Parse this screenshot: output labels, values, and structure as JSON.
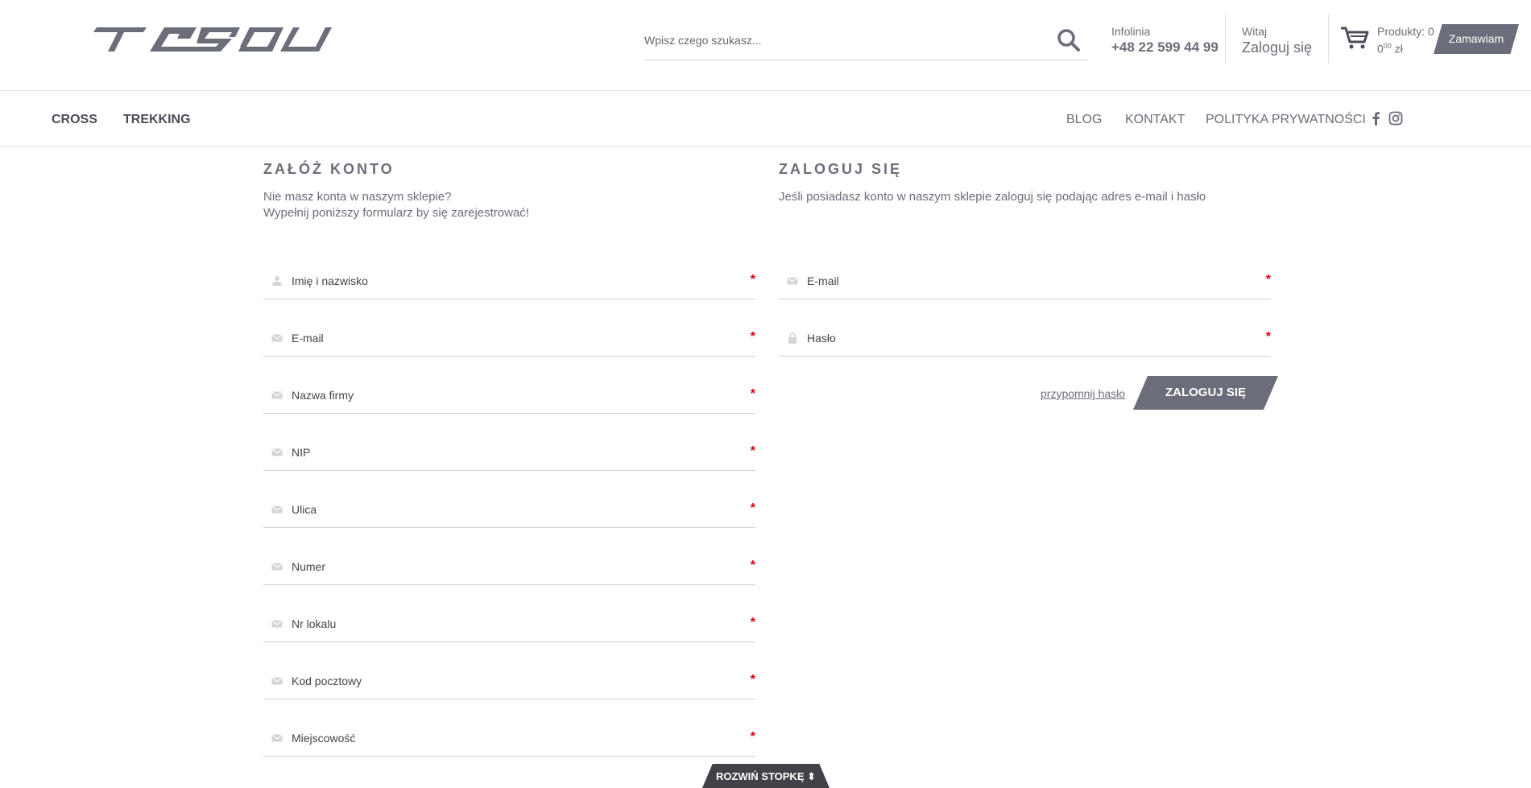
{
  "header": {
    "logo_alt": "TABOU",
    "search": {
      "placeholder": "Wpisz czego szukasz..."
    },
    "infolinia": {
      "label": "Infolinia",
      "phone": "+48 22 599 44 99"
    },
    "welcome": {
      "label": "Witaj",
      "login_link": "Zaloguj się"
    },
    "cart": {
      "products": "Produkty: 0",
      "price_main": "0",
      "price_sup": "00",
      "currency": " zł",
      "order_label": "Zamawiam"
    }
  },
  "nav": {
    "left": [
      "CROSS",
      "TREKKING"
    ],
    "right": [
      "BLOG",
      "KONTAKT",
      "POLITYKA PRYWATNOŚCI"
    ]
  },
  "register": {
    "title": "ZAŁÓŻ KONTO",
    "desc_line1": "Nie masz konta w naszym sklepie?",
    "desc_line2": "Wypełnij poniższy formularz by się zarejestrować!",
    "fields": [
      "Imię i nazwisko",
      "E-mail",
      "Nazwa firmy",
      "NIP",
      "Ulica",
      "Numer",
      "Nr lokalu",
      "Kod pocztowy",
      "Miejscowość"
    ],
    "required_mark": "*"
  },
  "login": {
    "title": "ZALOGUJ SIĘ",
    "desc": "Jeśli posiadasz konto w naszym sklepie zaloguj się podając adres e-mail i hasło",
    "fields": [
      "E-mail",
      "Hasło"
    ],
    "remind_label": "przypomnij hasło",
    "submit_label": "ZALOGUJ SIĘ",
    "required_mark": "*"
  },
  "footer": {
    "toggle_label": "ROZWIŃ STOPKĘ",
    "toggle_icon": "⬍"
  },
  "colors": {
    "accent": "#6b6e7a",
    "required": "#d4001a",
    "dark": "#404248"
  }
}
